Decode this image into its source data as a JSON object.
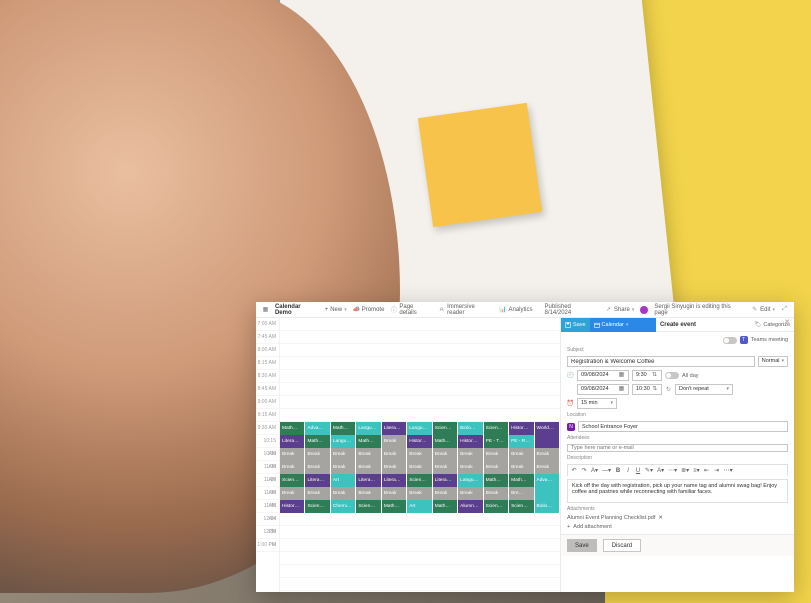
{
  "toolbar": {
    "page_title": "Calendar Demo",
    "new_label": "New",
    "promote_label": "Promote",
    "page_details_label": "Page details",
    "immersive_label": "Immersive reader",
    "analytics_label": "Analytics",
    "published_label": "Published 8/14/2024",
    "share_label": "Share",
    "editor_status": "Sergii Sinyugin is editing this page",
    "edit_label": "Edit"
  },
  "calendar": {
    "time_slots": [
      "7:00 AM",
      "7:45 AM",
      "8:00 AM",
      "8:15 AM",
      "8:30 AM",
      "8:45 AM",
      "9:00 AM",
      "9:15 AM",
      "9:30 AM",
      "10:15 AM",
      "10:30 AM",
      "11:00 AM",
      "11:15 AM",
      "11:30 AM",
      "11:45 AM",
      "12:14 PM",
      "12:30 PM",
      "1:00 PM"
    ],
    "rows": [
      [
        {
          "l": "Math…",
          "c": "green"
        },
        {
          "l": "Adva…",
          "c": "teal"
        },
        {
          "l": "Math…",
          "c": "green"
        },
        {
          "l": "Langu…",
          "c": "teal"
        },
        {
          "l": "Litera…",
          "c": "purple"
        },
        {
          "l": "Langu…",
          "c": "teal"
        },
        {
          "l": "Scien…",
          "c": "green"
        },
        {
          "l": "Biolo…",
          "c": "teal"
        },
        {
          "l": "Scien…",
          "c": "green"
        },
        {
          "l": "Histor…",
          "c": "purple"
        },
        {
          "l": "World…",
          "c": "purple"
        }
      ],
      [
        {
          "l": "Litera…",
          "c": "purple"
        },
        {
          "l": "Math…",
          "c": "green"
        },
        {
          "l": "Langu…",
          "c": "teal"
        },
        {
          "l": "Math…",
          "c": "green"
        },
        {
          "l": "Break",
          "c": "grey"
        },
        {
          "l": "Histor…",
          "c": "purple"
        },
        {
          "l": "Math…",
          "c": "green"
        },
        {
          "l": "Histor…",
          "c": "purple"
        },
        {
          "l": "PE - T…",
          "c": "green"
        },
        {
          "l": "PE - R…",
          "c": "teal"
        },
        {
          "l": "",
          "c": "purple"
        }
      ],
      [
        {
          "l": "Break",
          "c": "grey"
        },
        {
          "l": "Break",
          "c": "grey"
        },
        {
          "l": "Break",
          "c": "grey"
        },
        {
          "l": "Break",
          "c": "grey"
        },
        {
          "l": "Break",
          "c": "grey"
        },
        {
          "l": "Break",
          "c": "grey"
        },
        {
          "l": "Break",
          "c": "grey"
        },
        {
          "l": "Break",
          "c": "grey"
        },
        {
          "l": "Break",
          "c": "grey"
        },
        {
          "l": "Break",
          "c": "grey"
        },
        {
          "l": "Break",
          "c": "grey"
        }
      ],
      [
        {
          "l": "Break",
          "c": "grey"
        },
        {
          "l": "Break",
          "c": "grey"
        },
        {
          "l": "Break",
          "c": "grey"
        },
        {
          "l": "Break",
          "c": "grey"
        },
        {
          "l": "Break",
          "c": "grey"
        },
        {
          "l": "Break",
          "c": "grey"
        },
        {
          "l": "Break",
          "c": "grey"
        },
        {
          "l": "Break",
          "c": "grey"
        },
        {
          "l": "Break",
          "c": "grey"
        },
        {
          "l": "Break",
          "c": "grey"
        },
        {
          "l": "Break",
          "c": "grey"
        }
      ],
      [
        {
          "l": "Scien…",
          "c": "green"
        },
        {
          "l": "Litera…",
          "c": "purple"
        },
        {
          "l": "Art",
          "c": "teal"
        },
        {
          "l": "Litera…",
          "c": "purple"
        },
        {
          "l": "Litera…",
          "c": "purple"
        },
        {
          "l": "Scien…",
          "c": "green"
        },
        {
          "l": "Litera…",
          "c": "purple"
        },
        {
          "l": "Langu…",
          "c": "teal"
        },
        {
          "l": "Math…",
          "c": "green"
        },
        {
          "l": "Math…",
          "c": "green"
        },
        {
          "l": "Adva…",
          "c": "teal"
        }
      ],
      [
        {
          "l": "Break",
          "c": "grey"
        },
        {
          "l": "Break",
          "c": "grey"
        },
        {
          "l": "Break",
          "c": "grey"
        },
        {
          "l": "Break",
          "c": "grey"
        },
        {
          "l": "Break",
          "c": "grey"
        },
        {
          "l": "Break",
          "c": "grey"
        },
        {
          "l": "Break",
          "c": "grey"
        },
        {
          "l": "Break",
          "c": "grey"
        },
        {
          "l": "Break",
          "c": "grey"
        },
        {
          "l": "Bre…",
          "c": "grey"
        },
        {
          "l": "",
          "c": "teal"
        }
      ],
      [
        {
          "l": "Histor…",
          "c": "purple"
        },
        {
          "l": "Scien…",
          "c": "green"
        },
        {
          "l": "Chemi…",
          "c": "teal"
        },
        {
          "l": "Scien…",
          "c": "green"
        },
        {
          "l": "Math…",
          "c": "green"
        },
        {
          "l": "Art",
          "c": "teal"
        },
        {
          "l": "Math…",
          "c": "green"
        },
        {
          "l": "Alumn…",
          "c": "purple"
        },
        {
          "l": "Scien…",
          "c": "green"
        },
        {
          "l": "Scien…",
          "c": "green"
        },
        {
          "l": "Biolo…",
          "c": "teal"
        }
      ]
    ]
  },
  "dialog": {
    "save_btn": "Save",
    "calendar_btn": "Calendar",
    "title": "Create event",
    "categorize": "Categorize",
    "teams_meeting": "Teams meeting",
    "subject_label": "Subject",
    "subject_value": "Registration & Welcome Coffee",
    "importance_value": "Normal",
    "start_date": "09/08/2024",
    "start_time": "9:30",
    "allday_label": "All day",
    "end_date": "09/08/2024",
    "end_time": "10:30",
    "repeat_value": "Don't repeat",
    "reminder_value": "15 min",
    "location_label": "Location",
    "location_value": "School Entrance Foyer",
    "attendees_label": "Attendees",
    "attendees_placeholder": "Type here name or e-mail",
    "description_label": "Description",
    "description_value": "Kick off the day with registration, pick up your name tag and alumni swag bag! Enjoy coffee and pastries while reconnecting with familiar faces.",
    "attachments_label": "Attachments",
    "attachment_file": "Alumni Event Planning Checklist.pdf",
    "add_attachment": "Add attachment",
    "save_label": "Save",
    "discard_label": "Discard"
  }
}
